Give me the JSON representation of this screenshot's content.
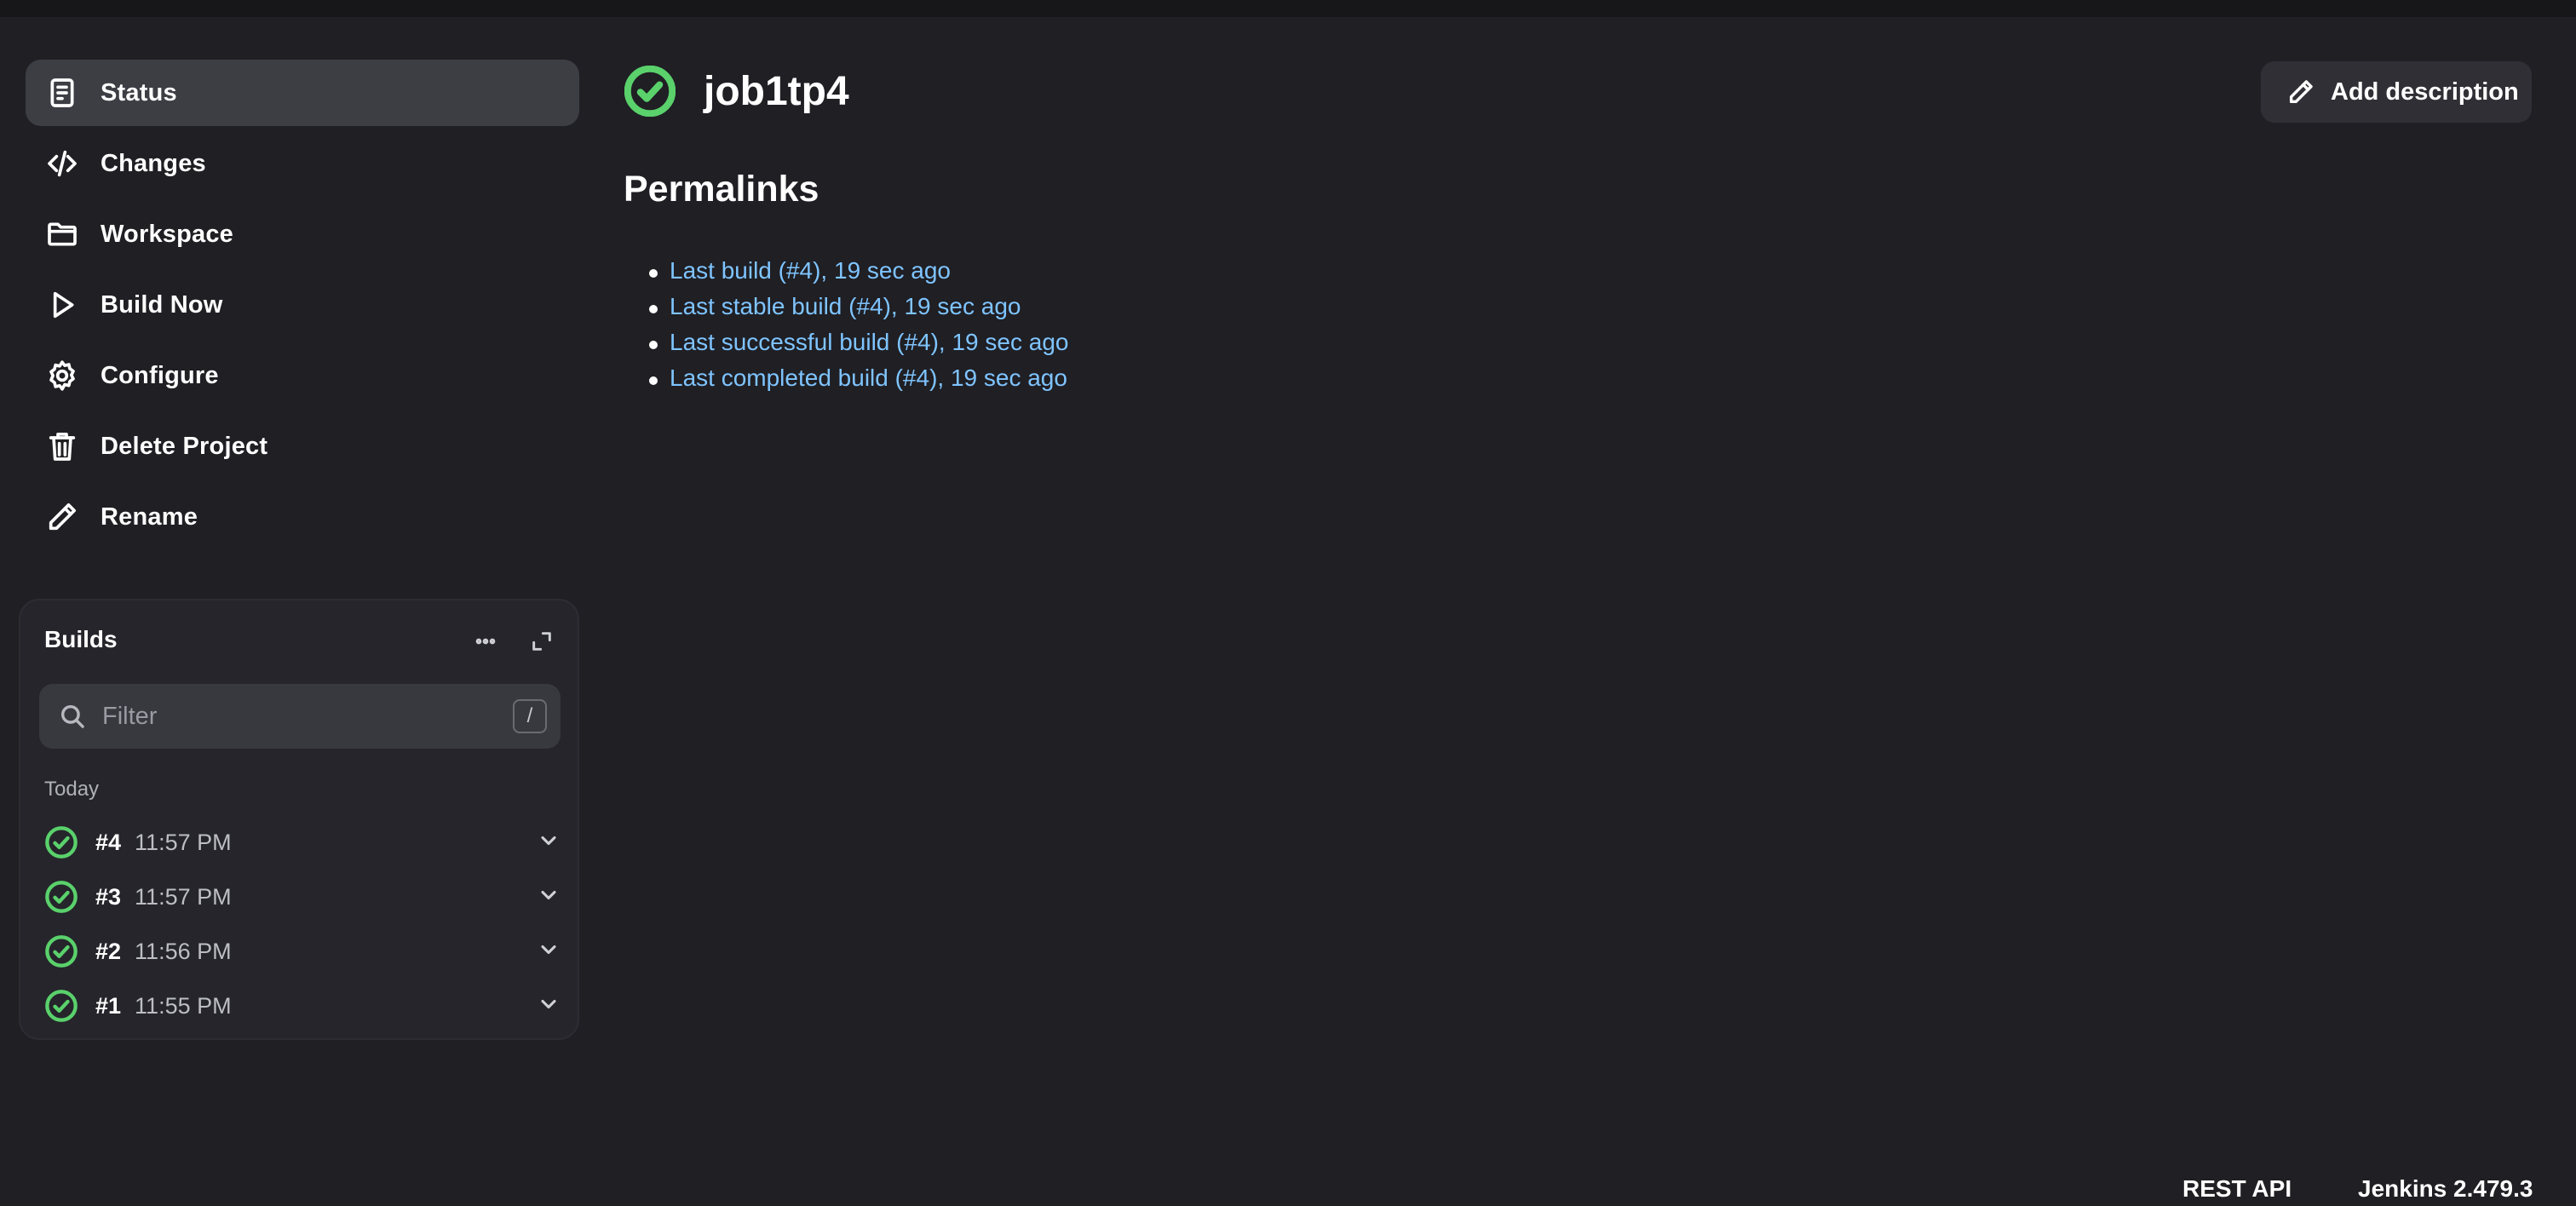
{
  "sidebar": {
    "tasks": [
      {
        "label": "Status",
        "icon": "document-icon"
      },
      {
        "label": "Changes",
        "icon": "code-icon"
      },
      {
        "label": "Workspace",
        "icon": "folder-icon"
      },
      {
        "label": "Build Now",
        "icon": "play-icon"
      },
      {
        "label": "Configure",
        "icon": "gear-icon"
      },
      {
        "label": "Delete Project",
        "icon": "trash-icon"
      },
      {
        "label": "Rename",
        "icon": "pencil-icon"
      }
    ]
  },
  "builds": {
    "title": "Builds",
    "filter_placeholder": "Filter",
    "filter_shortcut": "/",
    "group_label": "Today",
    "items": [
      {
        "number": "#4",
        "time": "11:57 PM",
        "status": "success"
      },
      {
        "number": "#3",
        "time": "11:57 PM",
        "status": "success"
      },
      {
        "number": "#2",
        "time": "11:56 PM",
        "status": "success"
      },
      {
        "number": "#1",
        "time": "11:55 PM",
        "status": "success"
      }
    ]
  },
  "main": {
    "job_title": "job1tp4",
    "add_description_label": "Add description",
    "permalinks_heading": "Permalinks",
    "permalinks": [
      "Last build (#4), 19 sec ago",
      "Last stable build (#4), 19 sec ago",
      "Last successful build (#4), 19 sec ago",
      "Last completed build (#4), 19 sec ago"
    ]
  },
  "footer": {
    "rest_api": "REST API",
    "version": "Jenkins 2.479.3"
  },
  "colors": {
    "background": "#1f1f24",
    "success": "#5ad16b",
    "link": "#7fc4ff",
    "active_item": "#3d3d44"
  }
}
